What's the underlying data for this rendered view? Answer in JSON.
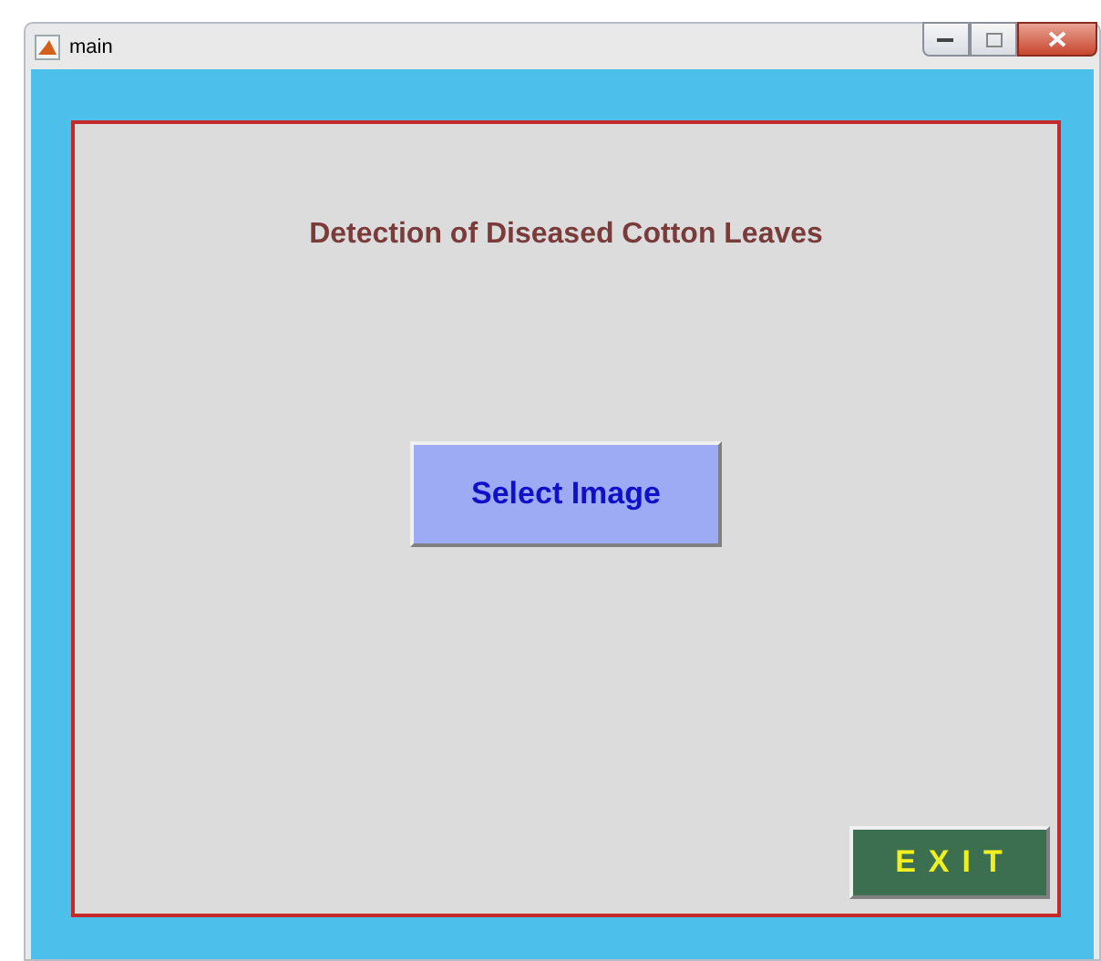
{
  "window": {
    "title": "main"
  },
  "panel": {
    "heading": "Detection of Diseased Cotton Leaves"
  },
  "buttons": [
    {
      "kind": "primary",
      "label": "Select Image"
    },
    {
      "kind": "exit",
      "label": "EXIT"
    }
  ]
}
